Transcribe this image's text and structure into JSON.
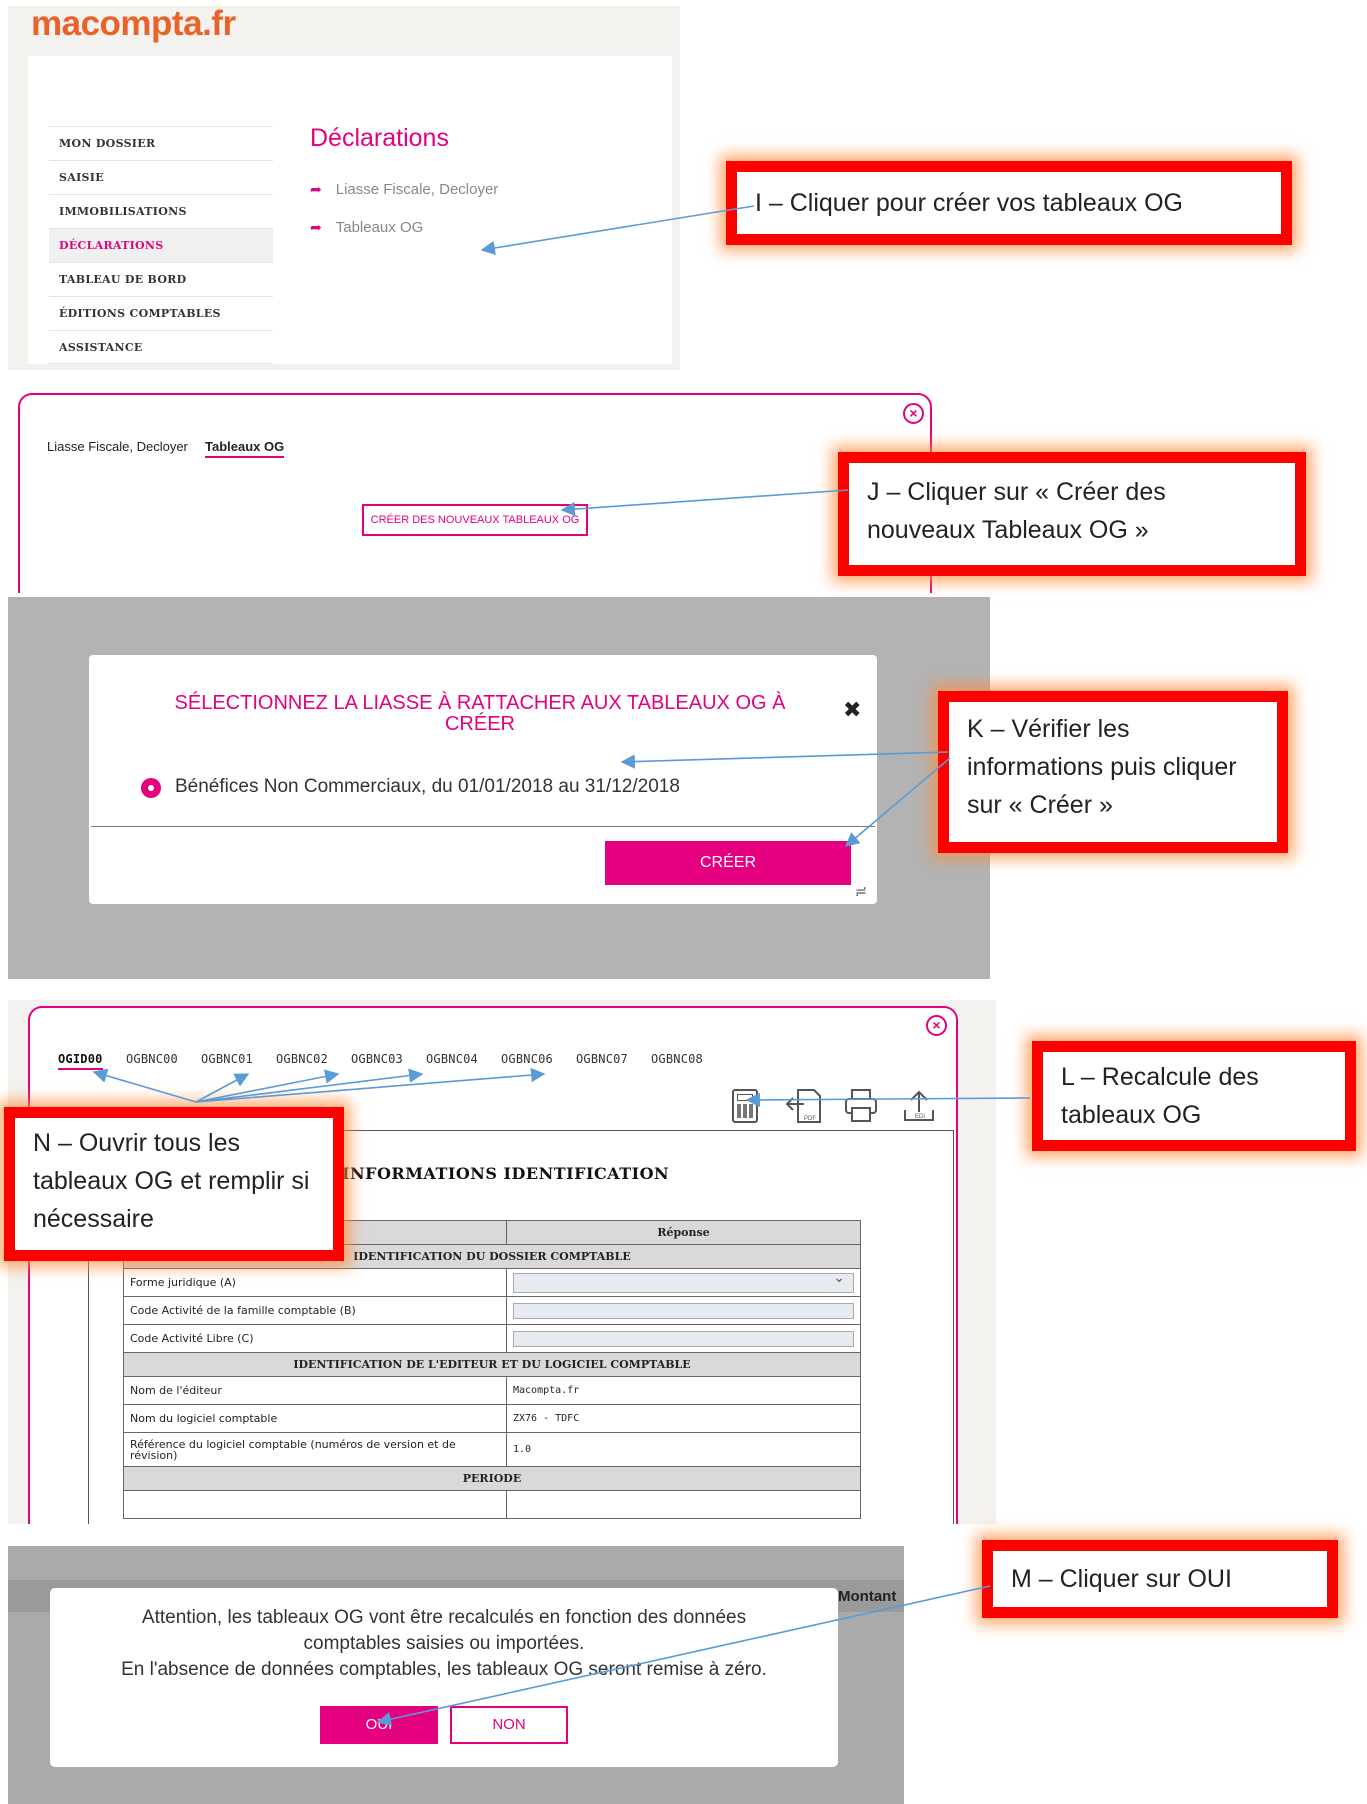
{
  "panel1": {
    "logo": {
      "part1": "macompta",
      "part2": ".fr"
    },
    "nav": [
      "MON DOSSIER",
      "SAISIE",
      "IMMOBILISATIONS",
      "DÉCLARATIONS",
      "TABLEAU DE BORD",
      "ÉDITIONS COMPTABLES",
      "ASSISTANCE"
    ],
    "title": "Déclarations",
    "links": [
      "Liasse Fiscale, Decloyer",
      "Tableaux OG"
    ]
  },
  "callouts": {
    "I": "I – Cliquer pour créer vos tableaux OG",
    "J": "J – Cliquer sur « Créer des nouveaux Tableaux OG »",
    "K": "K – Vérifier les informations puis cliquer sur « Créer  »",
    "L": "L – Recalcule des tableaux OG",
    "N": "N – Ouvrir tous les tableaux OG et remplir si nécessaire",
    "M": "M – Cliquer sur OUI"
  },
  "panel2": {
    "tabs": [
      "Liasse Fiscale, Decloyer",
      "Tableaux OG"
    ],
    "button": "CRÉER DES NOUVEAUX TABLEAUX OG",
    "close": "×"
  },
  "panel3": {
    "title": "SÉLECTIONNEZ LA LIASSE À RATTACHER AUX TABLEAUX OG À CRÉER",
    "close": "✖",
    "option": "Bénéfices Non Commerciaux, du 01/01/2018 au 31/12/2018",
    "button": "CRÉER"
  },
  "panel4": {
    "tabs": [
      "OGID00",
      "OGBNC00",
      "OGBNC01",
      "OGBNC02",
      "OGBNC03",
      "OGBNC04",
      "OGBNC06",
      "OGBNC07",
      "OGBNC08"
    ],
    "close": "×",
    "tools": {
      "pdf": "PDF",
      "edi": "EDI"
    },
    "section_title": "INFORMATIONS IDENTIFICATION",
    "table": {
      "header_right": "Réponse",
      "sect1": "IDENTIFICATION DU DOSSIER COMPTABLE",
      "row_forme": "Forme juridique (A)",
      "row_code_fam": "Code Activité de la famille comptable (B)",
      "row_code_libre": "Code Activité Libre (C)",
      "sect2": "IDENTIFICATION DE L'EDITEUR ET DU LOGICIEL COMPTABLE",
      "row_editeur": "Nom de l'éditeur",
      "val_editeur": "Macompta.fr",
      "row_logiciel": "Nom du logiciel comptable",
      "val_logiciel": "ZX76 - TDFC",
      "row_ref": "Référence du logiciel comptable (numéros de version et de révision)",
      "val_ref": "1.0",
      "sect3": "PERIODE"
    }
  },
  "panel5": {
    "col_header": "Montant",
    "message": [
      "Attention, les tableaux OG vont être recalculés en fonction des données",
      "comptables saisies ou importées.",
      "En l'absence de données comptables, les tableaux OG seront remise à zéro."
    ],
    "yes": "OUI",
    "no": "NON"
  },
  "colors": {
    "accent": "#e4007e",
    "callout_border": "#ff0000",
    "arrow": "#5b9bd5",
    "logo": "#e8622a"
  }
}
